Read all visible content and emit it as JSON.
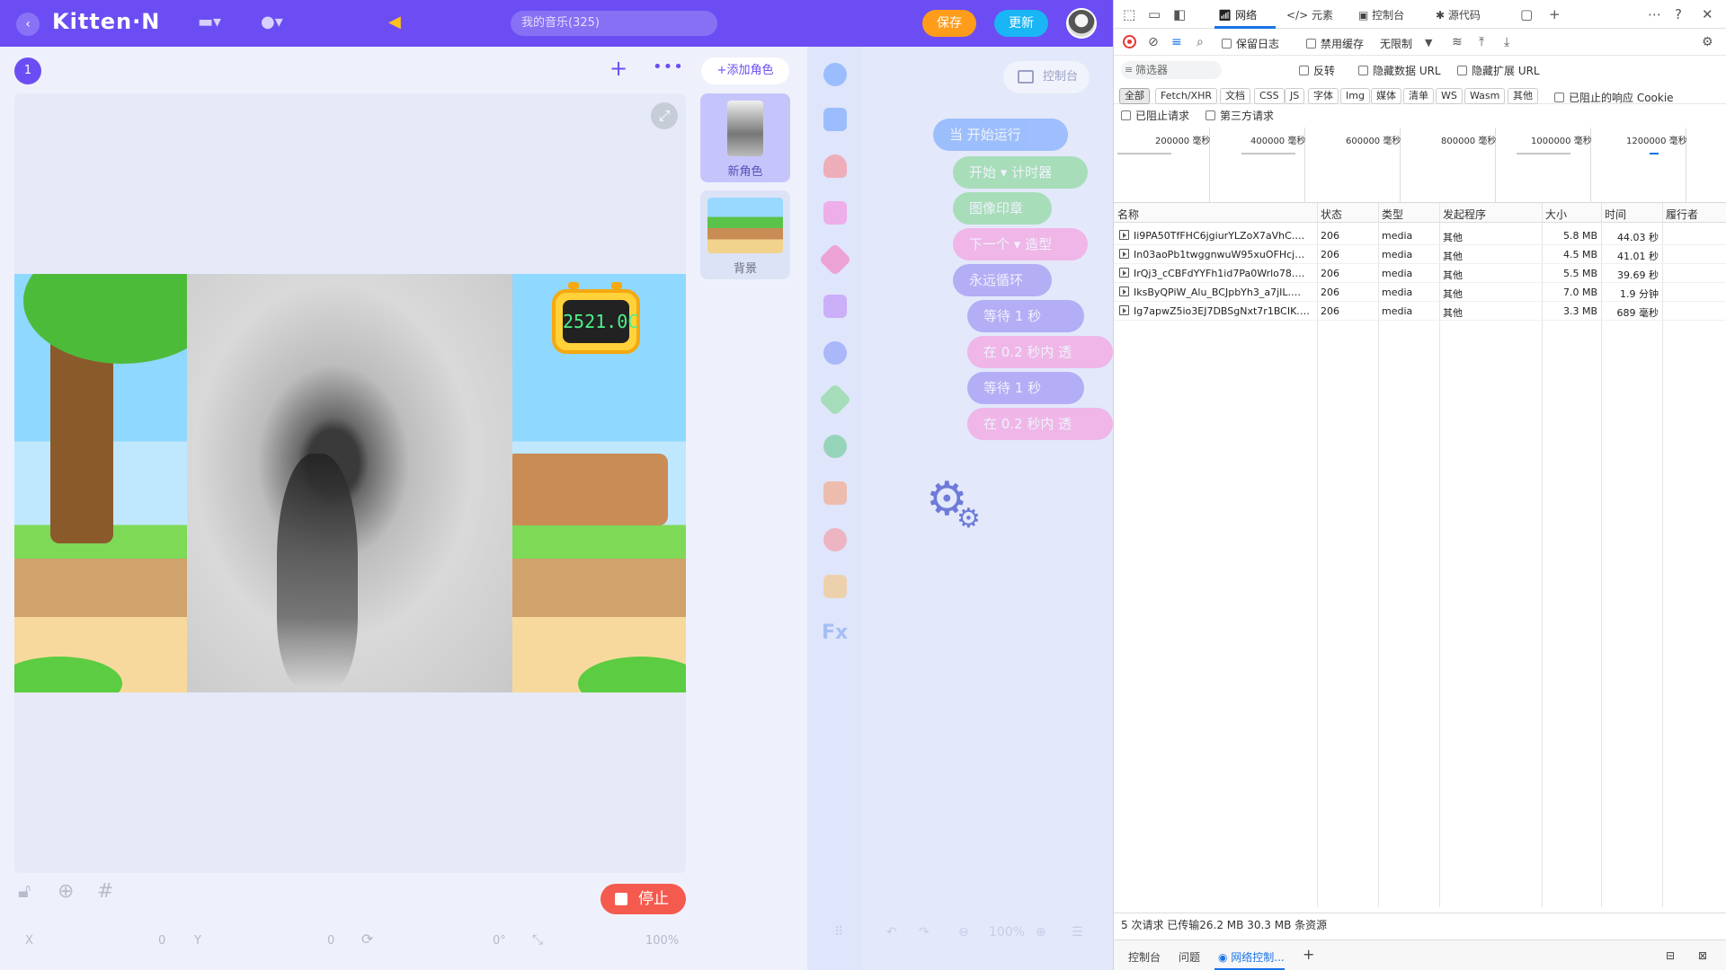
{
  "app": {
    "logo": "Kitten·N",
    "search_placeholder": "我的音乐(325)",
    "save_label": "保存",
    "update_label": "更新",
    "stage_number": "1",
    "add_sprite_label": "+添加角色",
    "sprites": [
      {
        "label": "新角色"
      },
      {
        "label": "背景"
      }
    ],
    "timer_value": "2521.0C",
    "stop_label": "停止",
    "console_label": "控制台",
    "coords": {
      "x_label": "X",
      "x_value": "0",
      "y_label": "Y",
      "y_value": "0",
      "rotation": "0°",
      "zoom": "100%"
    },
    "palette_zoom": "100%",
    "blocks": [
      {
        "text": "当 开始运行",
        "color": "#4a8cff"
      },
      {
        "text": "开始 ▾  计时器",
        "color": "#5fd06a"
      },
      {
        "text": "图像印章",
        "color": "#5fd06a"
      },
      {
        "text": "下一个 ▾  造型",
        "color": "#ff7ad1"
      },
      {
        "text": "永远循环",
        "color": "#7b68ee"
      },
      {
        "text": "等待  1  秒",
        "color": "#7b68ee"
      },
      {
        "text": "在  0.2  秒内  透",
        "color": "#ff7ad1"
      },
      {
        "text": "等待  1  秒",
        "color": "#7b68ee"
      },
      {
        "text": "在  0.2  秒内  透",
        "color": "#ff7ad1"
      }
    ],
    "colors": {
      "primary": "#6c4df3",
      "save": "#ff9c1a",
      "update": "#1ab5f5",
      "stop": "#f55a4e"
    }
  },
  "devtools": {
    "tabs": {
      "network": "网络",
      "elements": "元素",
      "console": "控制台",
      "sources": "源代码"
    },
    "toolbar": {
      "preserve_log": "保留日志",
      "disable_cache": "禁用缓存",
      "throttle": "无限制"
    },
    "filter": {
      "placeholder": "筛选器",
      "invert": "反转",
      "hide_data_url": "隐藏数据 URL",
      "hide_ext_url": "隐藏扩展 URL",
      "types": [
        "全部",
        "Fetch/XHR",
        "文档",
        "CSS",
        "JS",
        "字体",
        "Img",
        "媒体",
        "清单",
        "WS",
        "Wasm",
        "其他"
      ],
      "blocked_cookies": "已阻止的响应 Cookie",
      "blocked_requests": "已阻止请求",
      "third_party": "第三方请求"
    },
    "overview_labels": [
      "200000 毫秒",
      "400000 毫秒",
      "600000 毫秒",
      "800000 毫秒",
      "1000000 毫秒",
      "1200000 毫秒"
    ],
    "columns": {
      "name": "名称",
      "status": "状态",
      "type": "类型",
      "initiator": "发起程序",
      "size": "大小",
      "time": "时间",
      "waterfall": "履行者"
    },
    "requests": [
      {
        "name": "Ii9PA50TfFHC6jgiurYLZoX7aVhC.mp3",
        "status": "206",
        "type": "media",
        "initiator": "其他",
        "size": "5.8 MB",
        "time": "44.03 秒"
      },
      {
        "name": "In03aoPb1twggnwuW95xuOFHcjnT....",
        "status": "206",
        "type": "media",
        "initiator": "其他",
        "size": "4.5 MB",
        "time": "41.01 秒"
      },
      {
        "name": "IrQj3_cCBFdYYFh1id7Pa0Wrlo78.mp3",
        "status": "206",
        "type": "media",
        "initiator": "其他",
        "size": "5.5 MB",
        "time": "39.69 秒"
      },
      {
        "name": "IksByQPiW_Alu_BCJpbYh3_a7jIL.mp3",
        "status": "206",
        "type": "media",
        "initiator": "其他",
        "size": "7.0 MB",
        "time": "1.9 分钟"
      },
      {
        "name": "Ig7apwZ5io3EJ7DBSgNxt7r1BCIK.m...",
        "status": "206",
        "type": "media",
        "initiator": "其他",
        "size": "3.3 MB",
        "time": "689 毫秒"
      }
    ],
    "summary": "5 次请求  已传输26.2 MB  30.3 MB 条资源",
    "drawer": {
      "console": "控制台",
      "issues": "问题",
      "network_conditions": "网络控制..."
    }
  }
}
